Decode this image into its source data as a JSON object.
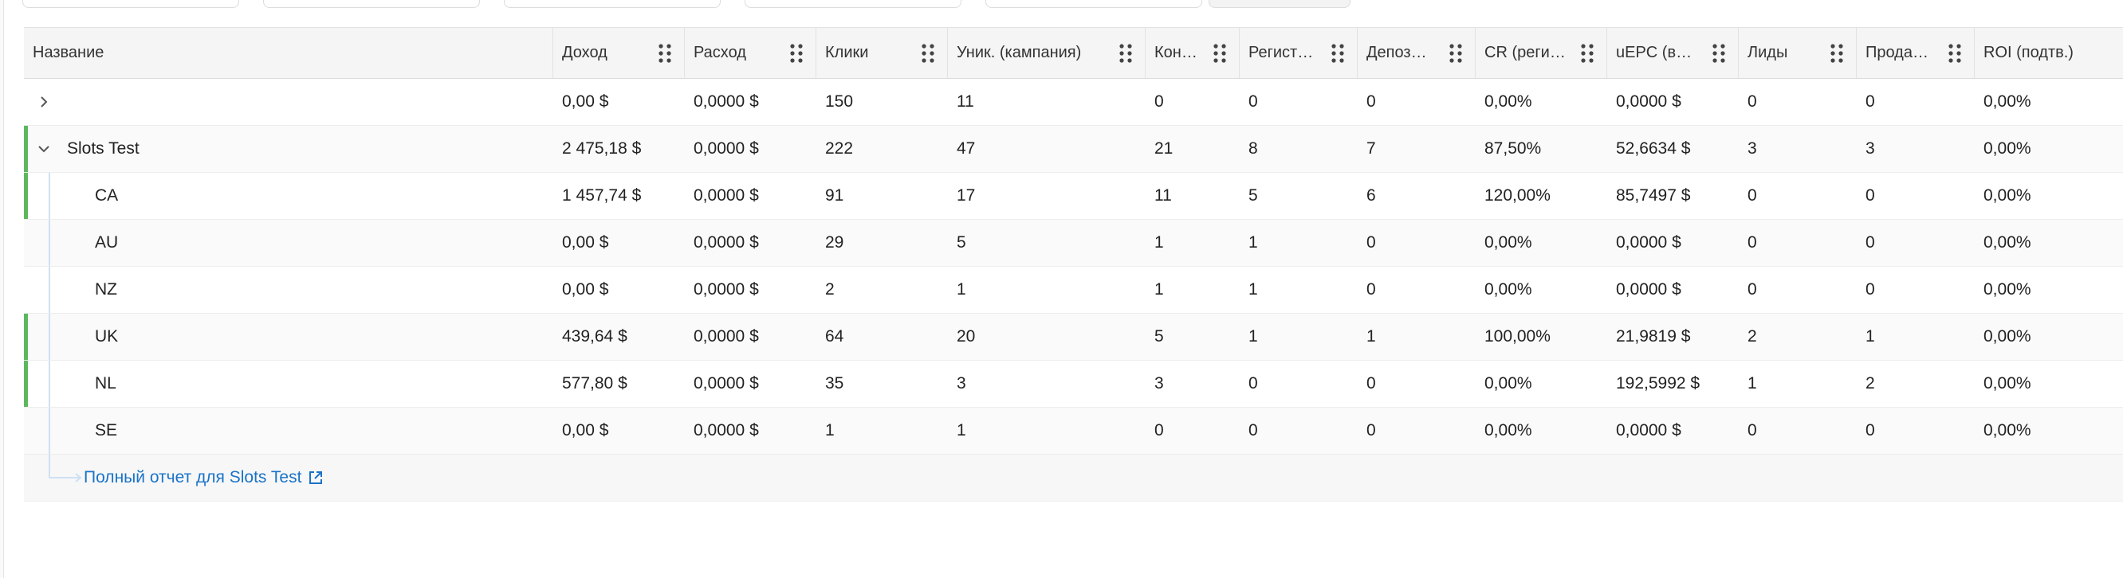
{
  "columns": [
    {
      "label": "Название"
    },
    {
      "label": "Доход"
    },
    {
      "label": "Расход"
    },
    {
      "label": "Клики"
    },
    {
      "label": "Уник. (кампания)"
    },
    {
      "label": "Кон…"
    },
    {
      "label": "Регист…"
    },
    {
      "label": "Депоз…"
    },
    {
      "label": "CR (реги…"
    },
    {
      "label": "uEPC (в…"
    },
    {
      "label": "Лиды"
    },
    {
      "label": "Прода…"
    },
    {
      "label": "ROI (подтв.)"
    }
  ],
  "rows": [
    {
      "name": "",
      "values": [
        "0,00 $",
        "0,0000 $",
        "150",
        "11",
        "0",
        "0",
        "0",
        "0,00%",
        "0,0000 $",
        "0",
        "0",
        "0,00%"
      ]
    },
    {
      "name": "Slots Test",
      "values": [
        "2 475,18 $",
        "0,0000 $",
        "222",
        "47",
        "21",
        "8",
        "7",
        "87,50%",
        "52,6634 $",
        "3",
        "3",
        "0,00%"
      ]
    },
    {
      "name": "CA",
      "values": [
        "1 457,74 $",
        "0,0000 $",
        "91",
        "17",
        "11",
        "5",
        "6",
        "120,00%",
        "85,7497 $",
        "0",
        "0",
        "0,00%"
      ]
    },
    {
      "name": "AU",
      "values": [
        "0,00 $",
        "0,0000 $",
        "29",
        "5",
        "1",
        "1",
        "0",
        "0,00%",
        "0,0000 $",
        "0",
        "0",
        "0,00%"
      ]
    },
    {
      "name": "NZ",
      "values": [
        "0,00 $",
        "0,0000 $",
        "2",
        "1",
        "1",
        "1",
        "0",
        "0,00%",
        "0,0000 $",
        "0",
        "0",
        "0,00%"
      ]
    },
    {
      "name": "UK",
      "values": [
        "439,64 $",
        "0,0000 $",
        "64",
        "20",
        "5",
        "1",
        "1",
        "100,00%",
        "21,9819 $",
        "2",
        "1",
        "0,00%"
      ]
    },
    {
      "name": "NL",
      "values": [
        "577,80 $",
        "0,0000 $",
        "35",
        "3",
        "3",
        "0",
        "0",
        "0,00%",
        "192,5992 $",
        "1",
        "2",
        "0,00%"
      ]
    },
    {
      "name": "SE",
      "values": [
        "0,00 $",
        "0,0000 $",
        "1",
        "1",
        "0",
        "0",
        "0",
        "0,00%",
        "0,0000 $",
        "0",
        "0",
        "0,00%"
      ]
    }
  ],
  "footer": {
    "link_label": "Полный отчет для Slots Test"
  },
  "icons": {
    "expand": "chevron-right-icon",
    "collapse": "chevron-down-icon",
    "drag": "drag-handle-icon",
    "external": "external-link-icon"
  },
  "colors": {
    "accent": "#5cb85c",
    "link": "#1a73c8"
  }
}
